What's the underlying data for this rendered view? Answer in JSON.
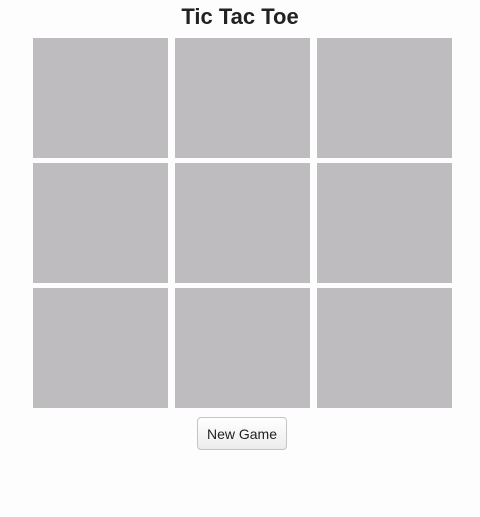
{
  "header": {
    "title": "Tic Tac Toe"
  },
  "board": {
    "rows": 3,
    "columns": 3,
    "cell_color": "#bebcbf",
    "cells": [
      {
        "mark": ""
      },
      {
        "mark": ""
      },
      {
        "mark": ""
      },
      {
        "mark": ""
      },
      {
        "mark": ""
      },
      {
        "mark": ""
      },
      {
        "mark": ""
      },
      {
        "mark": ""
      },
      {
        "mark": ""
      }
    ]
  },
  "controls": {
    "new_game_label": "New Game"
  }
}
